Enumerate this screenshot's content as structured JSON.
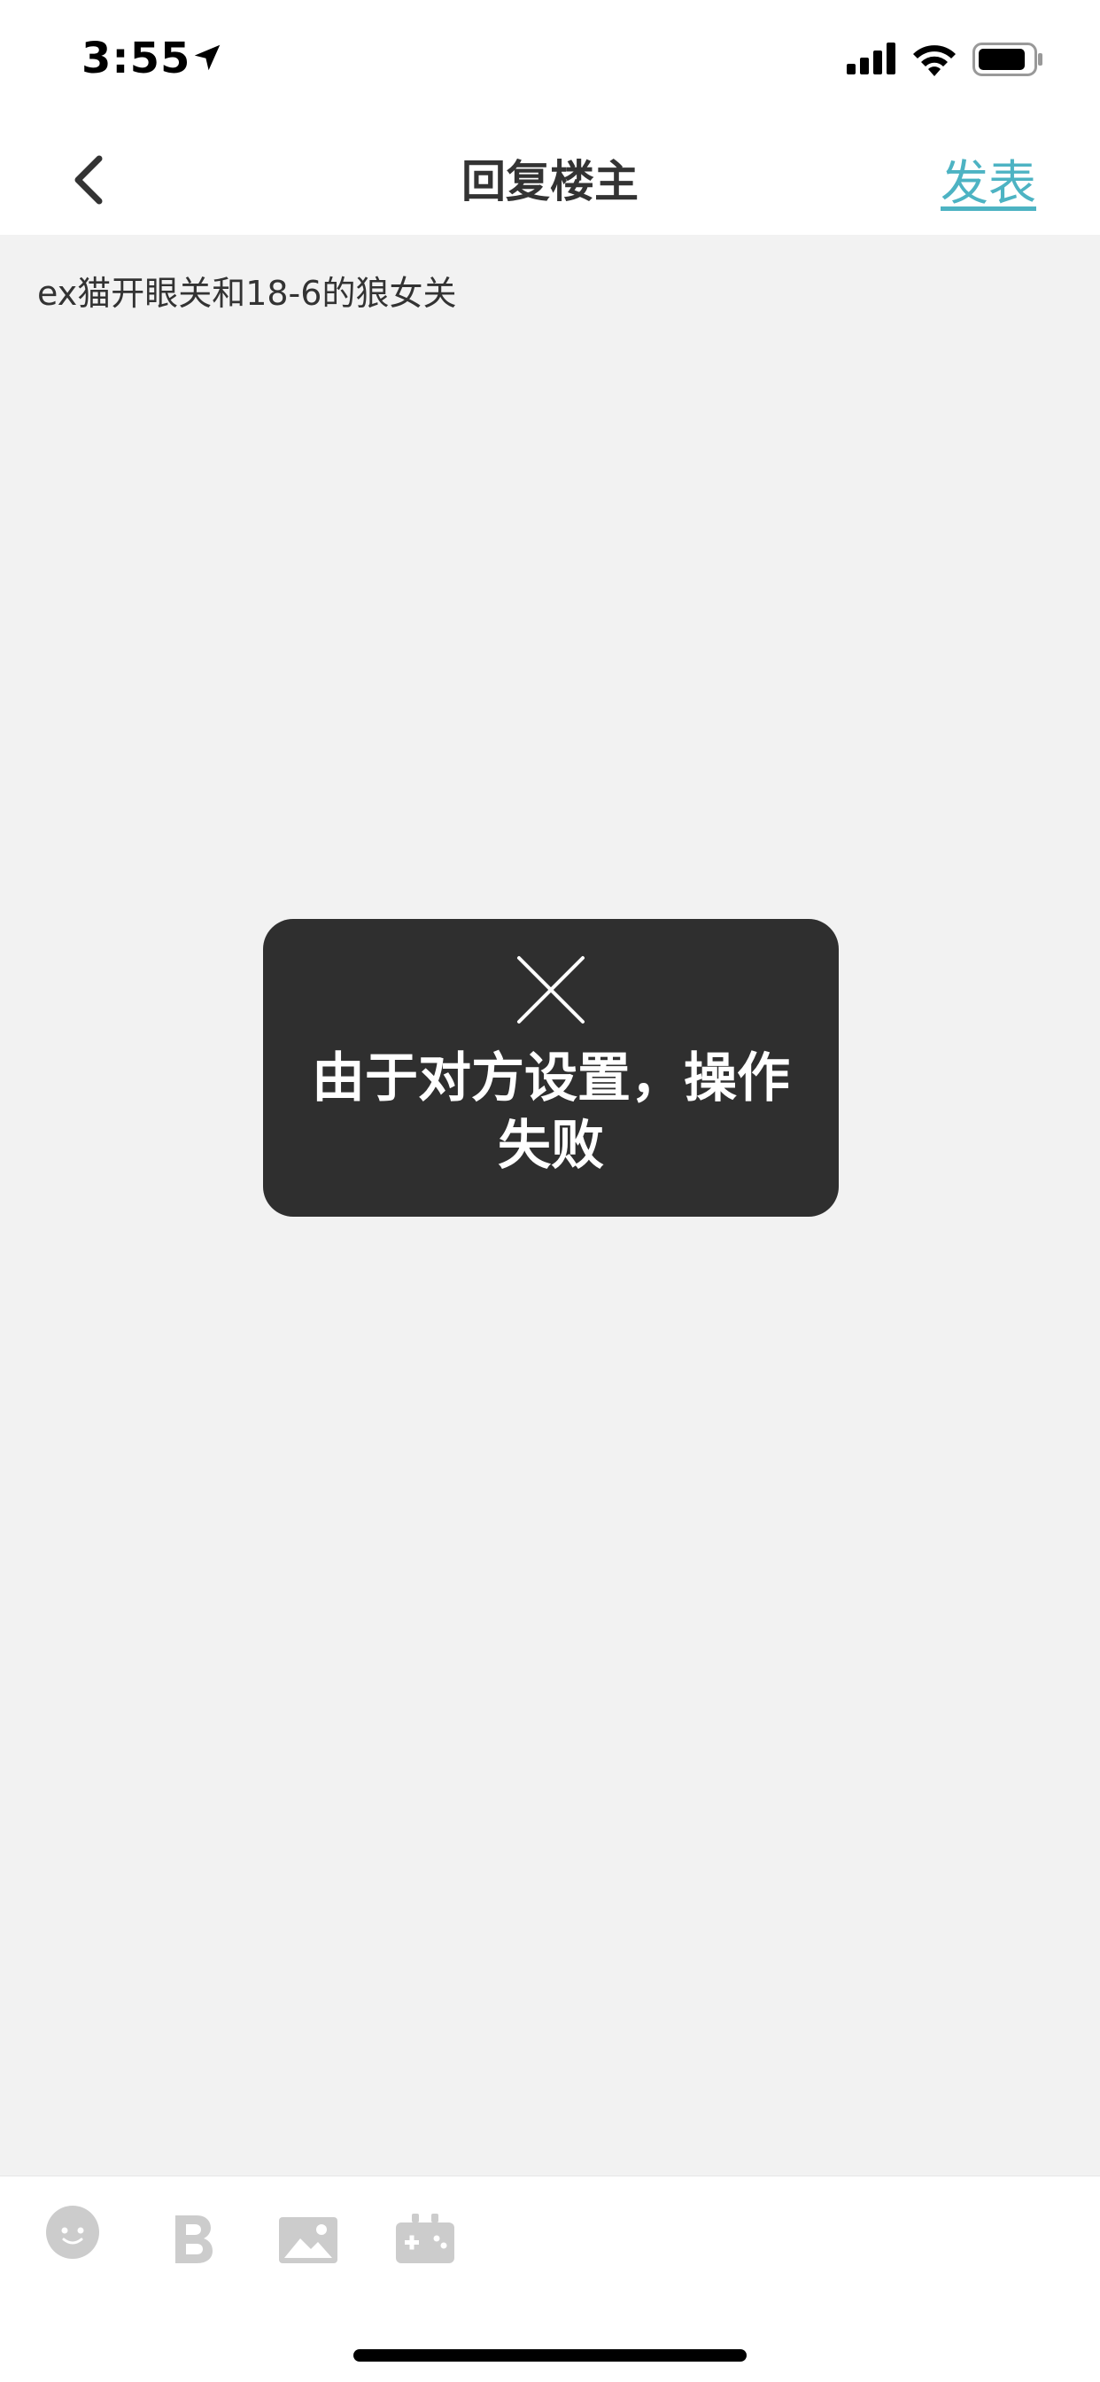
{
  "status_bar": {
    "time": "3:55"
  },
  "nav": {
    "title": "回复楼主",
    "publish_label": "发表"
  },
  "content": {
    "text": "ex猫开眼关和18-6的狼女关"
  },
  "toast": {
    "message": "由于对方设置，操作失败"
  },
  "toolbar": {
    "icons": [
      "emoji-icon",
      "bold-icon",
      "image-icon",
      "game-icon"
    ]
  },
  "colors": {
    "accent": "#4db3c3",
    "background": "#f2f2f2",
    "toast_bg": "#2f2f2f",
    "toolbar_icon": "#cccccc"
  }
}
